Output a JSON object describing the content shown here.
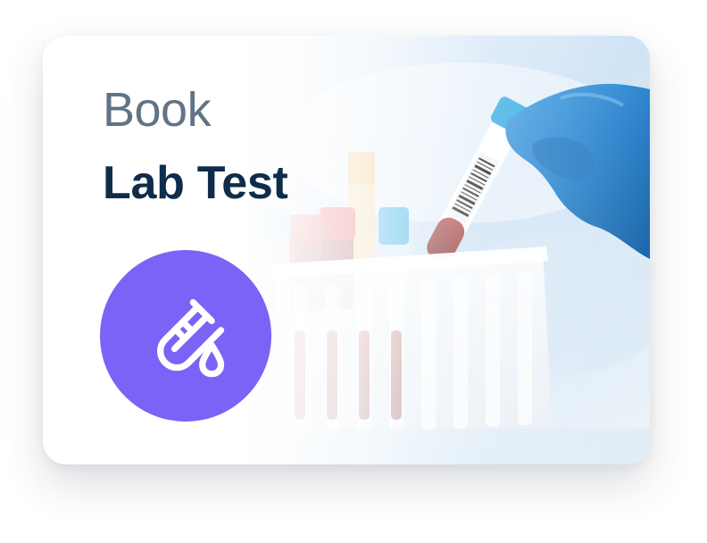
{
  "card": {
    "overline": "Book",
    "title": "Lab Test"
  },
  "icons": {
    "badge_icon": "test-tube-drop-icon"
  },
  "colors": {
    "overline_text": "#617485",
    "title_text": "#0f2c4a",
    "badge_background": "#7a63f6",
    "glove_blue": "#2f86cf"
  }
}
